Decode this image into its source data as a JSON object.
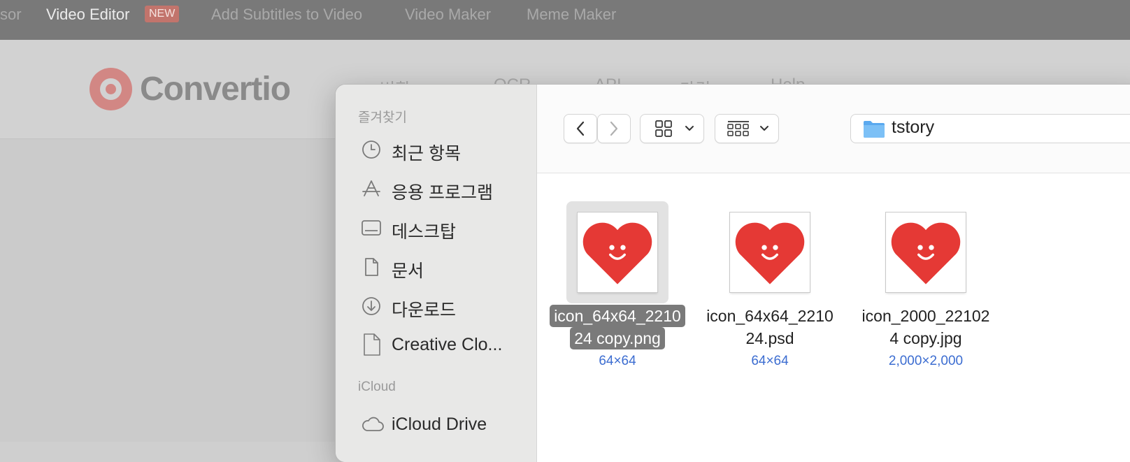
{
  "topnav": {
    "items": [
      "sor",
      "Video Editor",
      "Add Subtitles to Video",
      "Video Maker",
      "Meme Maker"
    ],
    "badge": "NEW"
  },
  "site": {
    "brand": "Convertio",
    "menu": [
      "변환",
      "OCR",
      "API",
      "가격",
      "Help"
    ]
  },
  "dialog": {
    "sidebar": {
      "favorites_title": "즐겨찾기",
      "favorites": [
        {
          "label": "최근 항목",
          "icon": "clock-icon"
        },
        {
          "label": "응용 프로그램",
          "icon": "applications-icon"
        },
        {
          "label": "데스크탑",
          "icon": "desktop-icon"
        },
        {
          "label": "문서",
          "icon": "document-icon"
        },
        {
          "label": "다운로드",
          "icon": "download-icon"
        },
        {
          "label": "Creative Clo...",
          "icon": "file-icon"
        }
      ],
      "icloud_title": "iCloud",
      "icloud": [
        {
          "label": "iCloud Drive",
          "icon": "cloud-icon"
        }
      ]
    },
    "toolbar": {
      "location": "tstory",
      "back_icon": "chevron-left-icon",
      "forward_icon": "chevron-right-icon",
      "view_icon": "grid-view-icon",
      "group_icon": "group-view-icon"
    },
    "files": [
      {
        "name_line1": "icon_64x64_2210",
        "name_line2": "24 copy.png",
        "dims": "64×64",
        "selected": true
      },
      {
        "name_line1": "icon_64x64_2210",
        "name_line2": "24.psd",
        "dims": "64×64",
        "selected": false
      },
      {
        "name_line1": "icon_2000_22102",
        "name_line2": "4 copy.jpg",
        "dims": "2,000×2,000",
        "selected": false
      }
    ],
    "colors": {
      "accent_blue": "#3c6dd1",
      "heart_red": "#e53935",
      "selection_gray": "#7a7a7a"
    }
  }
}
